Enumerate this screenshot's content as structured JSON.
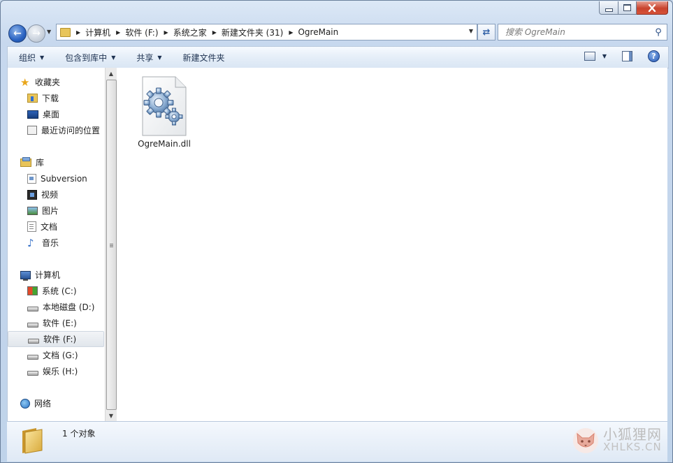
{
  "window": {
    "caption_buttons": {
      "minimize": "minimize",
      "maximize": "maximize",
      "close": "close"
    }
  },
  "address_bar": {
    "breadcrumbs": [
      "计算机",
      "软件 (F:)",
      "系统之家",
      "新建文件夹 (31)",
      "OgreMain"
    ]
  },
  "search": {
    "placeholder": "搜索 OgreMain"
  },
  "toolbar": {
    "organize": "组织",
    "include_in_library": "包含到库中",
    "share": "共享",
    "new_folder": "新建文件夹"
  },
  "nav_pane": {
    "favorites": {
      "label": "收藏夹",
      "items": [
        {
          "label": "下载",
          "icon": "download-folder-icon"
        },
        {
          "label": "桌面",
          "icon": "desktop-icon"
        },
        {
          "label": "最近访问的位置",
          "icon": "recent-places-icon"
        }
      ]
    },
    "libraries": {
      "label": "库",
      "items": [
        {
          "label": "Subversion",
          "icon": "svn-library-icon"
        },
        {
          "label": "视频",
          "icon": "video-icon"
        },
        {
          "label": "图片",
          "icon": "picture-icon"
        },
        {
          "label": "文档",
          "icon": "document-icon"
        },
        {
          "label": "音乐",
          "icon": "music-icon"
        }
      ]
    },
    "computer": {
      "label": "计算机",
      "items": [
        {
          "label": "系统 (C:)",
          "icon": "system-drive-icon"
        },
        {
          "label": "本地磁盘 (D:)",
          "icon": "drive-icon"
        },
        {
          "label": "软件 (E:)",
          "icon": "drive-icon"
        },
        {
          "label": "软件 (F:)",
          "icon": "drive-icon",
          "selected": true
        },
        {
          "label": "文档 (G:)",
          "icon": "drive-icon"
        },
        {
          "label": "娱乐 (H:)",
          "icon": "drive-icon"
        }
      ]
    },
    "network": {
      "label": "网络"
    }
  },
  "files": [
    {
      "name": "OgreMain.dll",
      "icon": "dll-gear-icon"
    }
  ],
  "status_bar": {
    "text": "1 个对象"
  },
  "watermark": {
    "cn": "小狐狸网",
    "en": "XHLKS.CN"
  },
  "colors": {
    "frame": "#c7d8ee",
    "selection": "#e1e6ec",
    "toolbar_text": "#1e3251",
    "close_button": "#c8432d"
  }
}
